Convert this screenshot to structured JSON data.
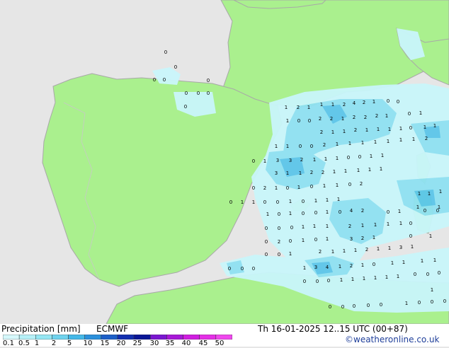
{
  "footer": {
    "product_label": "Precipitation [mm]",
    "model": "ECMWF",
    "valid_time": "Th 16-01-2025 12..15 UTC (00+87)",
    "credit": "©weatheronline.co.uk"
  },
  "legend": {
    "ticks": [
      "0.1",
      "0.5",
      "1",
      "2",
      "5",
      "10",
      "15",
      "20",
      "25",
      "30",
      "35",
      "40",
      "45",
      "50"
    ],
    "colors": [
      "#d6f8fb",
      "#b6f0f7",
      "#95e6f3",
      "#6fd3ee",
      "#44b8e8",
      "#2b90dc",
      "#1c5fc8",
      "#122fb0",
      "#0a1696",
      "#7a16d0",
      "#a818d8",
      "#d01ee0",
      "#e430e6",
      "#f048ee"
    ]
  },
  "map": {
    "colors": {
      "sea": "#e6e6e6",
      "land": "#aaf08e",
      "coast": "#a8a8a8",
      "precip_light": "#c9f6fb",
      "precip_medium": "#8fe1f2",
      "precip_heavy": "#5cc6ea"
    },
    "labels": [
      "0",
      "0",
      "0",
      "0",
      "0",
      "0",
      "0",
      "0",
      "0",
      "1",
      "2",
      "1",
      "1",
      "1",
      "2",
      "4",
      "2",
      "1",
      "0",
      "0",
      "1",
      "0",
      "0",
      "2",
      "2",
      "1",
      "2",
      "2",
      "2",
      "1",
      "0",
      "1",
      "2",
      "1",
      "1",
      "2",
      "1",
      "1",
      "1",
      "1",
      "0",
      "1",
      "1",
      "1",
      "1",
      "0",
      "0",
      "2",
      "1",
      "1",
      "1",
      "1",
      "1",
      "1",
      "1",
      "2",
      "0",
      "1",
      "3",
      "3",
      "2",
      "1",
      "1",
      "1",
      "0",
      "0",
      "1",
      "1",
      "3",
      "1",
      "1",
      "2",
      "2",
      "1",
      "1",
      "1",
      "1",
      "1",
      "0",
      "2",
      "1",
      "0",
      "1",
      "0",
      "1",
      "1",
      "0",
      "2",
      "1",
      "1",
      "1",
      "1",
      "0",
      "1",
      "1",
      "0",
      "0",
      "1",
      "0",
      "1",
      "1",
      "1",
      "4",
      "2",
      "1",
      "1",
      "0",
      "1",
      "0",
      "0",
      "1",
      "0",
      "0",
      "1",
      "0",
      "0",
      "0",
      "0",
      "0",
      "0",
      "1",
      "1",
      "1",
      "2",
      "1",
      "1",
      "1",
      "1",
      "0",
      "2",
      "0",
      "1",
      "0",
      "1",
      "3",
      "2",
      "1",
      "0",
      "1",
      "0",
      "0",
      "1",
      "2",
      "1",
      "1",
      "1",
      "2",
      "1",
      "1",
      "3",
      "1",
      "0",
      "0",
      "0",
      "1",
      "3",
      "4",
      "1",
      "2",
      "1",
      "0",
      "1",
      "1",
      "1",
      "1",
      "0",
      "0",
      "0",
      "1",
      "1",
      "1",
      "1",
      "1",
      "1",
      "0",
      "0",
      "0",
      "1",
      "0",
      "0",
      "0",
      "0",
      "0",
      "1",
      "0",
      "0",
      "0"
    ]
  }
}
